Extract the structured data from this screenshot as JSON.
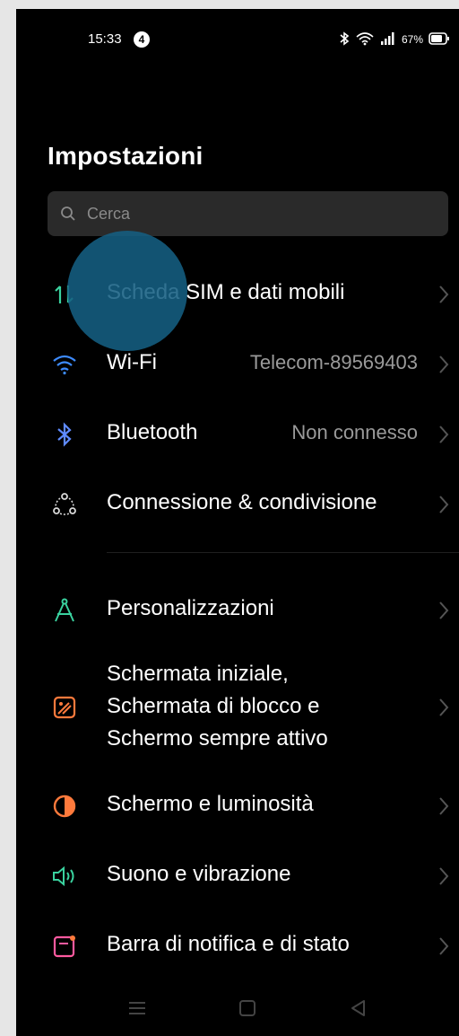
{
  "status": {
    "time": "15:33",
    "notification_count": "4",
    "battery": "67%"
  },
  "header": {
    "title": "Impostazioni"
  },
  "search": {
    "placeholder": "Cerca"
  },
  "settings": {
    "sim": {
      "label": "Scheda SIM e dati mobili",
      "icon": "data-arrows-icon"
    },
    "wifi": {
      "label": "Wi-Fi",
      "value": "Telecom-89569403",
      "icon": "wifi-icon"
    },
    "bluetooth": {
      "label": "Bluetooth",
      "value": "Non connesso",
      "icon": "bluetooth-icon"
    },
    "connection": {
      "label": "Connessione & condivisione",
      "icon": "connection-sharing-icon"
    },
    "personalization": {
      "label": "Personalizzazioni",
      "icon": "compass-icon"
    },
    "homescreen": {
      "line1": "Schermata iniziale,",
      "line2": "Schermata di blocco e",
      "line3": "Schermo sempre attivo",
      "icon": "wallpaper-icon"
    },
    "display": {
      "label": "Schermo e luminosità",
      "icon": "brightness-icon"
    },
    "sound": {
      "label": "Suono e vibrazione",
      "icon": "speaker-icon"
    },
    "notifications": {
      "label": "Barra di notifica e di stato",
      "icon": "notification-bar-icon"
    }
  },
  "colors": {
    "accent_green": "#3ad29f",
    "wifi_blue": "#3d8bff",
    "bluetooth_blue": "#5f8bff",
    "orange": "#ff7a3c",
    "touch_highlight": "#145f82"
  }
}
